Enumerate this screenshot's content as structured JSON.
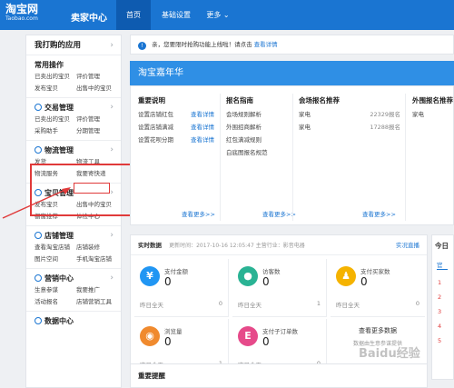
{
  "header": {
    "logo_main": "淘宝网",
    "logo_sub": "Taobao.com",
    "title": "卖家中心",
    "nav": [
      "首页",
      "基础设置",
      "更多 ⌄"
    ]
  },
  "sidebar": {
    "title": "我打购的应用",
    "groups": [
      {
        "title": "常用操作",
        "icon": "",
        "links": [
          "已卖出的宝贝",
          "评价管理",
          "发布宝贝",
          "出售中的宝贝"
        ]
      },
      {
        "title": "交易管理",
        "icon": "trade-icon",
        "links": [
          "已卖出的宝贝",
          "评价管理",
          "采购助手",
          "分期管理"
        ]
      },
      {
        "title": "物流管理",
        "icon": "logistics-icon",
        "links": [
          "发货",
          "物流工具",
          "物流服务",
          "我要寄快递"
        ]
      },
      {
        "title": "宝贝管理",
        "icon": "item-icon",
        "links": [
          "发布宝贝",
          "出售中的宝贝",
          "橱窗推荐",
          "体检中心"
        ]
      },
      {
        "title": "店铺管理",
        "icon": "shop-icon",
        "links": [
          "查看淘宝店铺",
          "店铺装修",
          "图片空间",
          "手机淘宝店铺"
        ]
      },
      {
        "title": "营销中心",
        "icon": "marketing-icon",
        "links": [
          "生意参谋",
          "我要推广",
          "活动报名",
          "店铺营销工具"
        ]
      },
      {
        "title": "数据中心",
        "icon": "data-icon",
        "links": []
      }
    ]
  },
  "notice_bar": {
    "text": "亲，您要限时抢购功能上线啦！请点击",
    "link": "查看详情"
  },
  "banner": {
    "title": "淘宝嘉年华"
  },
  "sections": {
    "important": {
      "title": "重要说明",
      "rows": [
        {
          "label": "设置店铺红包",
          "link": "查看详情"
        },
        {
          "label": "设置店铺满减",
          "link": "查看详情"
        },
        {
          "label": "设置花呗分期",
          "link": "查看详情"
        }
      ],
      "more": "查看更多>>"
    },
    "signup": {
      "title": "报名指南",
      "rows": [
        "会场规则解析",
        "外围招商解析",
        "红包满减规则",
        "白底图报名规范"
      ],
      "more": "查看更多>>"
    },
    "venue": {
      "title": "会场报名推荐",
      "rows": [
        {
          "label": "家电",
          "value": "22329报名"
        },
        {
          "label": "家电",
          "value": "17288报名"
        }
      ],
      "more": "查看更多>>"
    },
    "outer": {
      "title": "外围报名推荐",
      "rows": [
        "家电"
      ]
    }
  },
  "realtime": {
    "title": "实时数据",
    "updated": "更新时间：2017-10-16 12:05:47 主营行业：",
    "industry": "影音电器",
    "link": "实况直播",
    "cards": [
      {
        "label": "支付金额",
        "value": "0",
        "foot": "昨日全天",
        "foot_val": "0",
        "color": "#2196f3",
        "glyph": "¥"
      },
      {
        "label": "访客数",
        "value": "0",
        "foot": "昨日全天",
        "foot_val": "1",
        "color": "#2ab394",
        "glyph": "●"
      },
      {
        "label": "支付买家数",
        "value": "0",
        "foot": "昨日全天",
        "foot_val": "0",
        "color": "#f5b300",
        "glyph": "♟"
      },
      {
        "label": "浏览量",
        "value": "0",
        "foot": "昨日全天",
        "foot_val": "1",
        "color": "#f08a2e",
        "glyph": "◉"
      },
      {
        "label": "支付子订单数",
        "value": "0",
        "foot": "昨日全天",
        "foot_val": "0",
        "color": "#e64a8a",
        "glyph": "E"
      }
    ],
    "more_data": "查看更多数据",
    "more_sub": "数据由生意参谋提供"
  },
  "today": {
    "title": "今日",
    "tab": "官",
    "rows": [
      "1",
      "2",
      "3",
      "4",
      "5"
    ]
  },
  "notice": {
    "title": "重要提醒"
  },
  "watermark": "Baidu经验"
}
